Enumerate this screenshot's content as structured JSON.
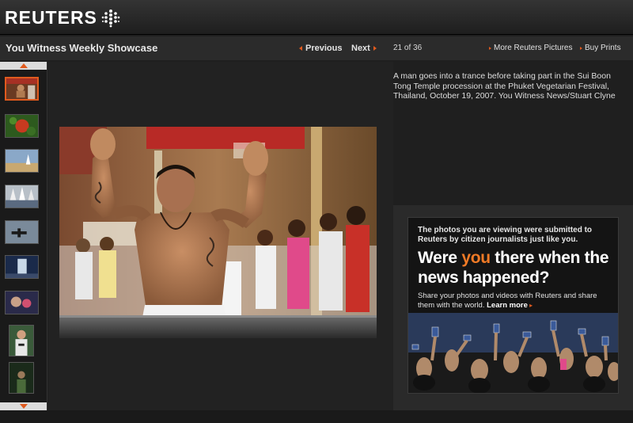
{
  "header": {
    "logo_text": "REUTERS"
  },
  "titlebar": {
    "title": "You Witness Weekly Showcase",
    "previous_label": "Previous",
    "next_label": "Next",
    "counter": "21 of 36",
    "more_pictures_label": "More Reuters Pictures",
    "buy_prints_label": "Buy Prints"
  },
  "photo": {
    "caption": "A man goes into a trance before taking part in the Sui Boon Tong Temple procession at the Phuket Vegetarian Festival, Thailand, October 19, 2007. You Witness News/Stuart Clyne"
  },
  "ad": {
    "intro": "The photos you are viewing were submitted to Reuters by citizen journalists just like you.",
    "headline_pre": "Were ",
    "headline_highlight": "you",
    "headline_post": " there when the news happened?",
    "body": "Share your photos and videos with Reuters and share them with the world.",
    "learn_more": "Learn more"
  },
  "colors": {
    "accent": "#e05a1e",
    "ad_highlight": "#f07a26"
  },
  "icons": {
    "scroll_up": "triangle-up",
    "scroll_down": "triangle-down",
    "previous": "arrow-left",
    "next": "arrow-right"
  }
}
